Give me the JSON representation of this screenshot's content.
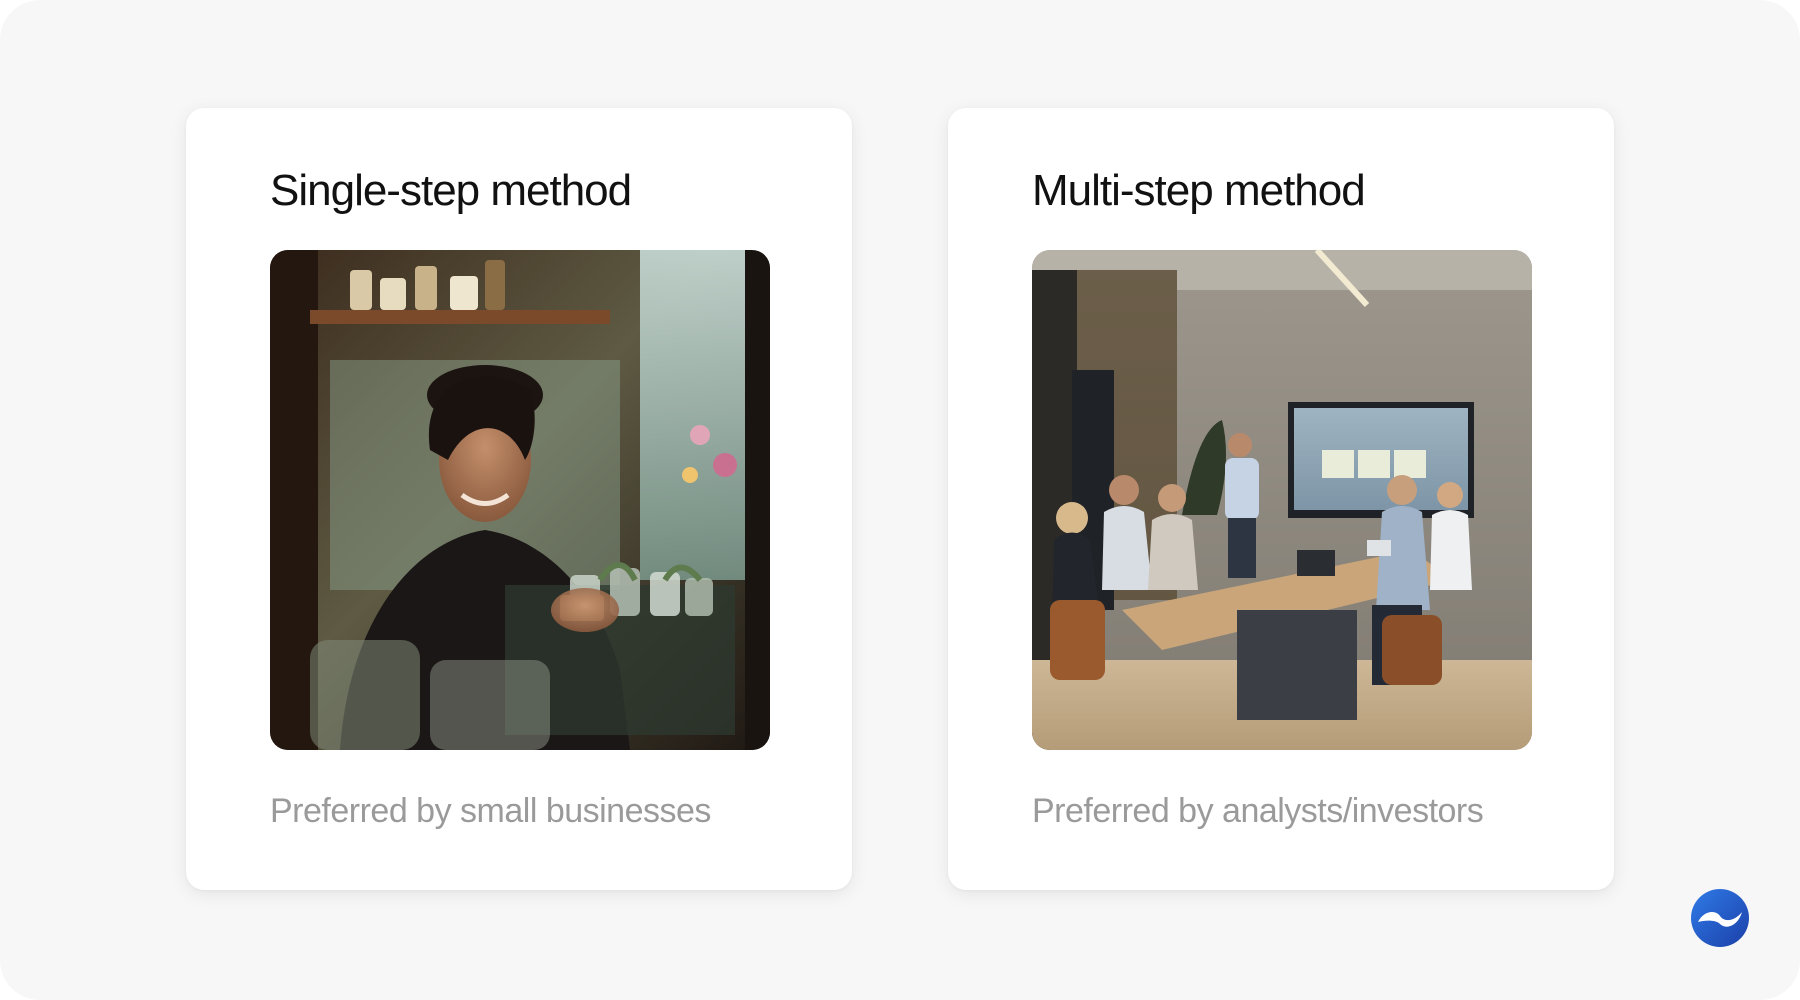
{
  "cards": [
    {
      "title": "Single-step method",
      "caption": "Preferred by small businesses",
      "photo_subject": "woman-at-shop-counter-with-jars"
    },
    {
      "title": "Multi-step method",
      "caption": "Preferred by analysts/investors",
      "photo_subject": "business-meeting-conference-room"
    }
  ],
  "logo": {
    "icon": "brand-logo-icon",
    "colors": [
      "#2f7be8",
      "#1c3fa8"
    ]
  },
  "colors": {
    "background": "#f7f7f7",
    "card": "#ffffff",
    "title": "#111111",
    "caption": "#9a9a9a"
  }
}
